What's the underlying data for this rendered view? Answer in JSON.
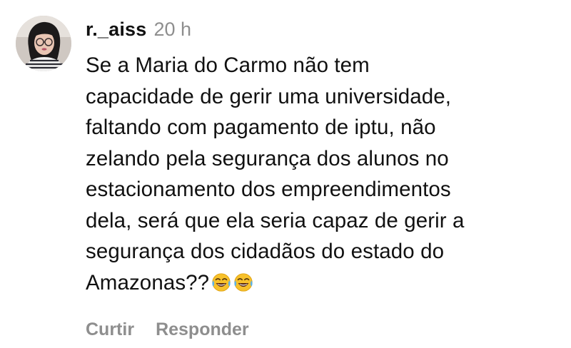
{
  "comment": {
    "username": "r._aiss",
    "timestamp": "20 h",
    "lines": [
      "Se a Maria do Carmo não tem",
      "capacidade de gerir uma universidade,",
      "faltando com pagamento de iptu, não",
      "zelando pela segurança dos alunos no",
      "estacionamento dos empreendimentos",
      "dela, será que ela seria capaz de gerir a",
      "segurança dos cidadãos do estado do",
      "Amazonas??"
    ],
    "emojis": [
      "😂",
      "😂"
    ],
    "emoji_icons": [
      "face-with-tears-of-joy-icon",
      "face-with-tears-of-joy-icon"
    ]
  },
  "actions": {
    "like_label": "Curtir",
    "reply_label": "Responder"
  },
  "colors": {
    "text": "#111111",
    "muted": "#8e8e8e",
    "background": "#ffffff",
    "emoji_yellow": "#f7c12b"
  }
}
